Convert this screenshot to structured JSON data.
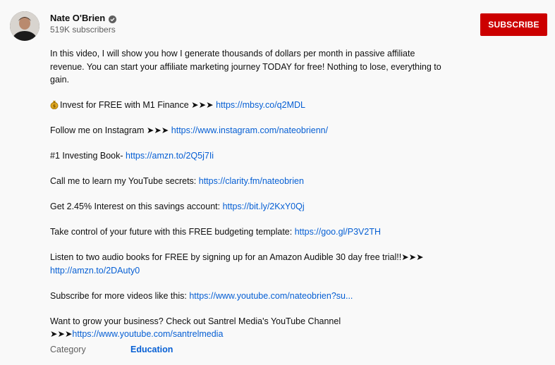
{
  "channel": {
    "name": "Nate O'Brien",
    "subscribers": "519K subscribers",
    "subscribe_label": "SUBSCRIBE"
  },
  "description": {
    "intro": "In this video, I will show you how I generate thousands of dollars per month in passive affiliate revenue. You can start your affiliate marketing journey TODAY for free! Nothing to lose, everything to gain.",
    "m1_text": "Invest for FREE with M1 Finance ➤➤➤ ",
    "m1_link": "https://mbsy.co/q2MDL",
    "instagram_text": "Follow me on Instagram ➤➤➤ ",
    "instagram_link": "https://www.instagram.com/nateobrienn/",
    "book_text": "#1 Investing Book- ",
    "book_link": "https://amzn.to/2Q5j7Ii",
    "clarity_text": "Call me to learn my YouTube secrets: ",
    "clarity_link": "https://clarity.fm/nateobrien",
    "savings_text": "Get 2.45% Interest on this savings account: ",
    "savings_link": "https://bit.ly/2KxY0Qj",
    "budget_text": "Take control of your future with this FREE budgeting template: ",
    "budget_link": "https://goo.gl/P3V2TH",
    "audible_text": "Listen to two audio books for FREE by signing up for an Amazon Audible 30 day free trial!!➤➤➤",
    "audible_link": "http://amzn.to/2DAuty0",
    "subscribe_text": "Subscribe for more videos like this: ",
    "subscribe_link": "https://www.youtube.com/nateobrien?su...",
    "santrel_text": "Want to grow your business? Check out Santrel Media's YouTube Channel",
    "santrel_arrows": "➤➤➤",
    "santrel_link": "https://www.youtube.com/santrelmedia"
  },
  "category": {
    "label": "Category",
    "value": "Education"
  },
  "colors": {
    "subscribe_bg": "#cc0000",
    "link": "#065fd4",
    "secondary_text": "#606060",
    "background": "#f9f9f9"
  },
  "icons": {
    "verified": "verified-check-icon",
    "moneybag": "moneybag-icon"
  }
}
